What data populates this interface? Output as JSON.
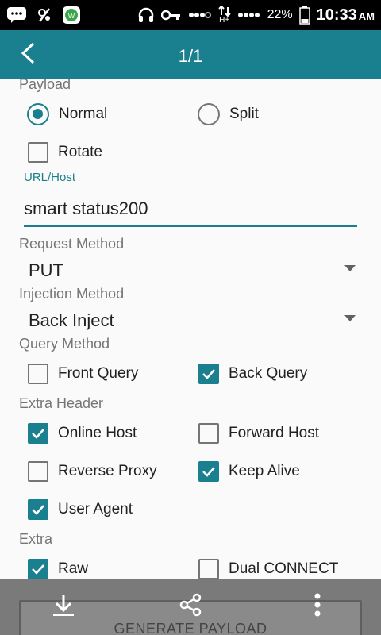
{
  "status_bar": {
    "icons": [
      "bbm-icon",
      "no-sim-icon",
      "whatsapp-like-app-icon",
      "headset-icon",
      "key-icon",
      "signal-dots-icon",
      "data-arrows-icon",
      "signal-dots-icon"
    ],
    "network_type": "H+",
    "battery": "22%",
    "time": "10:33",
    "ampm": "AM"
  },
  "app_bar": {
    "title": "1/1",
    "back_icon": "back-arrow-icon",
    "color": "#1a7f8e"
  },
  "payload": {
    "label": "Payload",
    "normal_label": "Normal",
    "split_label": "Split",
    "rotate_label": "Rotate",
    "selected": "Normal",
    "rotate_checked": false
  },
  "url_host": {
    "label": "URL/Host",
    "value": "smart status200"
  },
  "request_method": {
    "label": "Request Method",
    "value": "PUT"
  },
  "injection_method": {
    "label": "Injection Method",
    "value": "Back Inject"
  },
  "query_method": {
    "label": "Query Method",
    "front_query_label": "Front Query",
    "front_query_checked": false,
    "back_query_label": "Back Query",
    "back_query_checked": true
  },
  "extra_header": {
    "label": "Extra Header",
    "online_host_label": "Online Host",
    "online_host_checked": true,
    "forward_host_label": "Forward Host",
    "forward_host_checked": false,
    "reverse_proxy_label": "Reverse Proxy",
    "reverse_proxy_checked": false,
    "keep_alive_label": "Keep Alive",
    "keep_alive_checked": true,
    "user_agent_label": "User Agent",
    "user_agent_checked": true
  },
  "extra": {
    "label": "Extra",
    "raw_label": "Raw",
    "raw_checked": true,
    "dual_connect_label": "Dual CONNECT",
    "dual_connect_checked": false
  },
  "bottom_bar": {
    "generate_label": "GENERATE PAYLOAD",
    "icons": [
      "download-icon",
      "share-icon",
      "more-vert-icon"
    ]
  }
}
